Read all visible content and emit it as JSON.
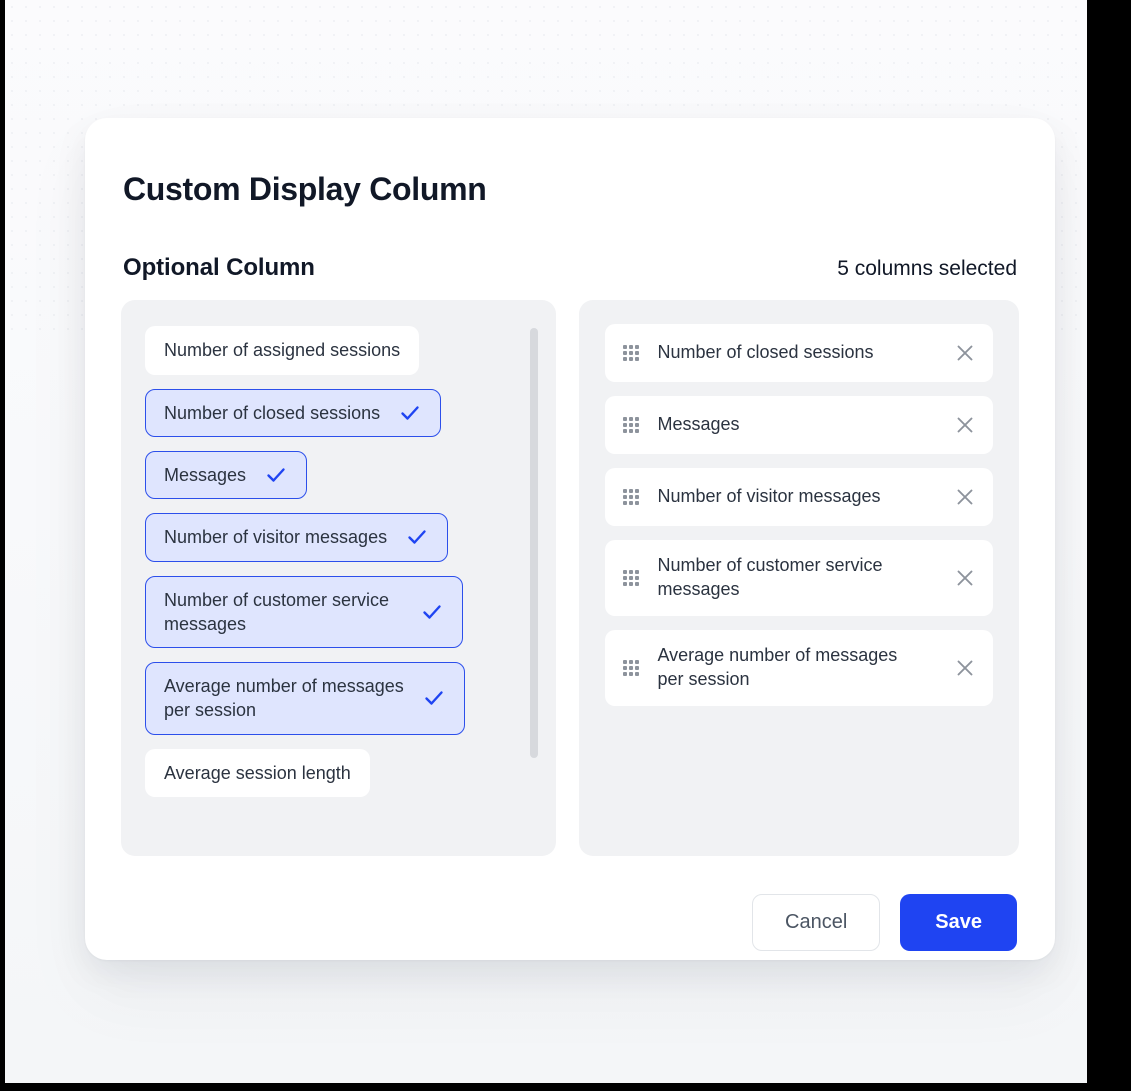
{
  "modal": {
    "title": "Custom Display Column",
    "section_title": "Optional Column",
    "selected_count_label": "5 columns selected",
    "colors": {
      "accent_blue": "#1f44f2",
      "chip_selected_bg": "#dfe5fe",
      "chip_selected_border": "#2c4feb",
      "panel_bg": "#f1f2f4",
      "text": "#2b3340",
      "icon_gray": "#8d939c"
    }
  },
  "optional_columns": [
    {
      "label": "Number of assigned sessions",
      "selected": false
    },
    {
      "label": "Number of closed sessions",
      "selected": true
    },
    {
      "label": "Messages",
      "selected": true
    },
    {
      "label": "Number of visitor messages",
      "selected": true
    },
    {
      "label": "Number of customer service\nmessages",
      "selected": true
    },
    {
      "label": "Average number of messages\nper session",
      "selected": true
    },
    {
      "label": "Average session length",
      "selected": false
    }
  ],
  "selected_columns": [
    {
      "label": "Number of closed sessions"
    },
    {
      "label": "Messages"
    },
    {
      "label": "Number of visitor messages"
    },
    {
      "label": "Number of customer service\nmessages"
    },
    {
      "label": "Average number of messages\nper session"
    }
  ],
  "icons": {
    "check": "check-icon",
    "drag": "drag-handle-icon",
    "remove": "close-icon"
  },
  "footer": {
    "cancel_label": "Cancel",
    "save_label": "Save"
  }
}
